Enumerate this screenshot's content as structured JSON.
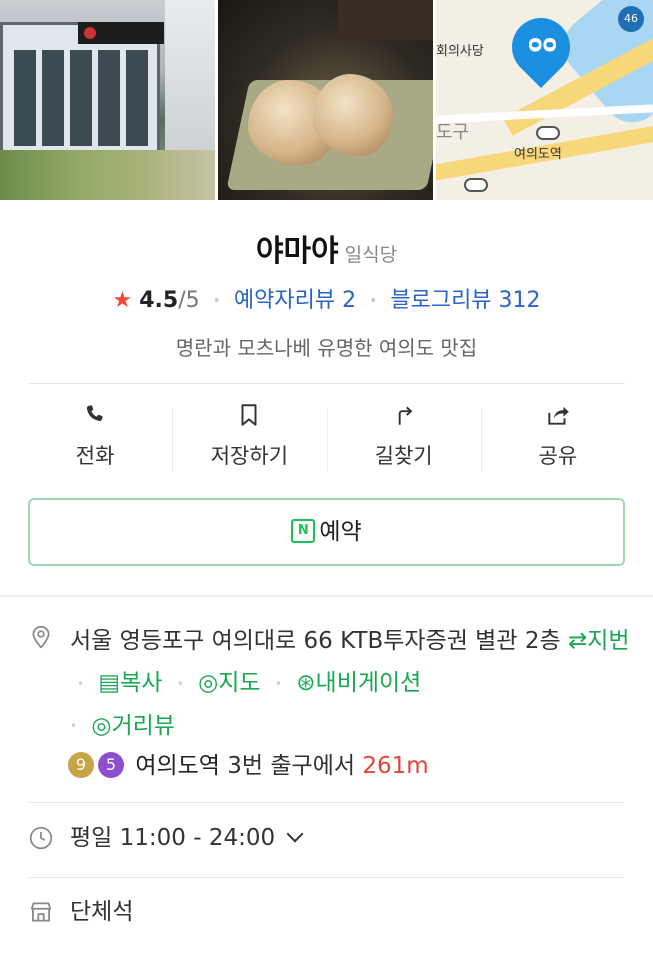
{
  "photos": {
    "map_label_1": "회의사당",
    "map_label_2": "여의도역",
    "map_label_3": "도구",
    "map_route_number": "46"
  },
  "place": {
    "name": "야마야",
    "category": "일식당",
    "rating": "4.5",
    "rating_max": "/5",
    "reserve_review": "예약자리뷰 2",
    "blog_review": "블로그리뷰 312",
    "description": "명란과 모츠나베 유명한 여의도 맛집"
  },
  "actions": [
    {
      "label": "전화",
      "icon": "phone-icon"
    },
    {
      "label": "저장하기",
      "icon": "bookmark-icon"
    },
    {
      "label": "길찾기",
      "icon": "directions-icon"
    },
    {
      "label": "공유",
      "icon": "share-icon"
    }
  ],
  "reserve": {
    "label": "예약",
    "icon_letter": "N"
  },
  "address": {
    "text": "서울 영등포구 여의대로 66 KTB투자증권 별관 2층",
    "chips": [
      "⇄지번",
      "복사",
      "지도",
      "내비게이션",
      "거리뷰"
    ]
  },
  "subway": {
    "lines": [
      {
        "number": "9",
        "color": "#c7a447"
      },
      {
        "number": "5",
        "color": "#8c4fd0"
      }
    ],
    "station": "여의도역",
    "exit_text": "3번 출구에서",
    "distance": "261m"
  },
  "hours": {
    "text": "평일 11:00 - 24:00"
  },
  "seating": {
    "text": "단체석"
  },
  "colors": {
    "accent_green": "#19a851",
    "link_blue": "#2a64c4",
    "star_red": "#f0463c"
  }
}
